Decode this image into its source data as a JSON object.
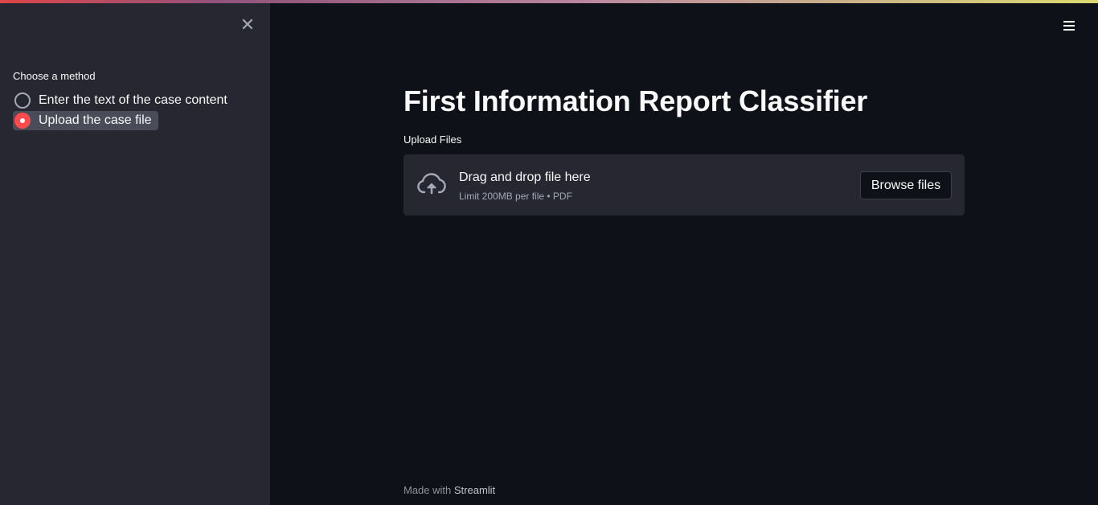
{
  "sidebar": {
    "close_icon": "close-icon",
    "radio_group": {
      "label": "Choose a method",
      "options": [
        {
          "label": "Enter the text of the case content",
          "selected": false
        },
        {
          "label": "Upload the case file",
          "selected": true
        }
      ]
    }
  },
  "header": {
    "menu_icon": "hamburger-menu-icon"
  },
  "main": {
    "title": "First Information Report Classifier",
    "uploader": {
      "label": "Upload Files",
      "icon": "cloud-upload-icon",
      "dropzone_title": "Drag and drop file here",
      "dropzone_subtitle": "Limit 200MB per file • PDF",
      "browse_button": "Browse files"
    }
  },
  "footer": {
    "prefix": "Made with ",
    "brand": "Streamlit"
  },
  "colors": {
    "accent": "#ff4b4b",
    "background": "#0e1117",
    "sidebar_background": "#262730",
    "text": "#fafafa"
  }
}
